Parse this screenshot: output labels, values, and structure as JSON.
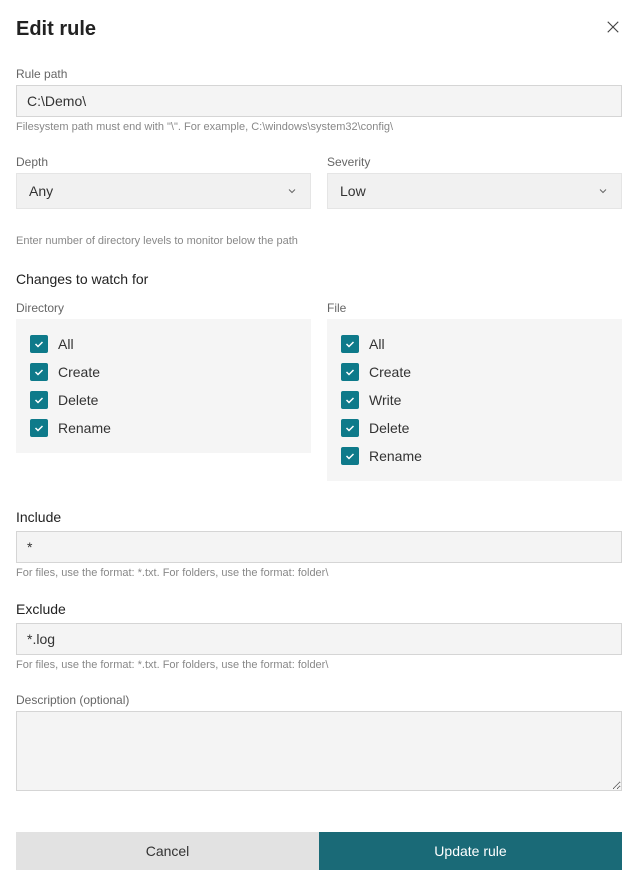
{
  "header": {
    "title": "Edit rule"
  },
  "rule_path": {
    "label": "Rule path",
    "value": "C:\\Demo\\",
    "help": "Filesystem path must end with \"\\\". For example, C:\\windows\\system32\\config\\"
  },
  "depth": {
    "label": "Depth",
    "value": "Any",
    "help": "Enter number of directory levels to monitor below the path"
  },
  "severity": {
    "label": "Severity",
    "value": "Low"
  },
  "changes": {
    "title": "Changes to watch for",
    "directory": {
      "label": "Directory",
      "items": [
        {
          "label": "All",
          "checked": true
        },
        {
          "label": "Create",
          "checked": true
        },
        {
          "label": "Delete",
          "checked": true
        },
        {
          "label": "Rename",
          "checked": true
        }
      ]
    },
    "file": {
      "label": "File",
      "items": [
        {
          "label": "All",
          "checked": true
        },
        {
          "label": "Create",
          "checked": true
        },
        {
          "label": "Write",
          "checked": true
        },
        {
          "label": "Delete",
          "checked": true
        },
        {
          "label": "Rename",
          "checked": true
        }
      ]
    }
  },
  "include": {
    "label": "Include",
    "value": "*",
    "help": "For files, use the format: *.txt. For folders, use the format: folder\\"
  },
  "exclude": {
    "label": "Exclude",
    "value": "*.log",
    "help": "For files, use the format: *.txt. For folders, use the format: folder\\"
  },
  "description": {
    "label": "Description (optional)",
    "value": ""
  },
  "buttons": {
    "cancel": "Cancel",
    "update": "Update rule"
  },
  "colors": {
    "accent": "#0e7a8a",
    "primary_button": "#1a6a77"
  }
}
